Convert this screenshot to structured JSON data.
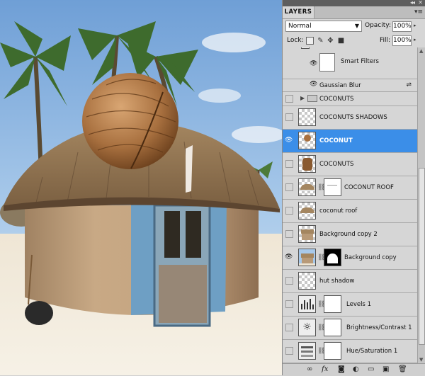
{
  "panel": {
    "tab_label": "LAYERS",
    "blend_mode": "Normal",
    "opacity_label": "Opacity:",
    "opacity_value": "100%",
    "lock_label": "Lock:",
    "fill_label": "Fill:",
    "fill_value": "100%"
  },
  "layers": [
    {
      "name": "Smart Filters",
      "kind": "smart-filters",
      "visible": true
    },
    {
      "name": "Gaussian Blur",
      "kind": "filter",
      "visible": true
    },
    {
      "name": "COCONUTS",
      "kind": "group",
      "visible": false
    },
    {
      "name": "COCONUTS SHADOWS",
      "kind": "layer",
      "visible": false
    },
    {
      "name": "COCONUT",
      "kind": "layer",
      "visible": true,
      "selected": true
    },
    {
      "name": "COCONUTS",
      "kind": "layer",
      "visible": false
    },
    {
      "name": "COCONUT ROOF",
      "kind": "masked",
      "visible": false
    },
    {
      "name": "coconut roof",
      "kind": "layer",
      "visible": false
    },
    {
      "name": "Background copy 2",
      "kind": "layer",
      "visible": false
    },
    {
      "name": "Background copy",
      "kind": "masked",
      "visible": true
    },
    {
      "name": "hut shadow",
      "kind": "layer",
      "visible": false
    },
    {
      "name": "Levels 1",
      "kind": "adjustment",
      "visible": false
    },
    {
      "name": "Brightness/Contrast 1",
      "kind": "adjustment",
      "visible": false
    },
    {
      "name": "Hue/Saturation 1",
      "kind": "adjustment",
      "visible": false
    }
  ],
  "icons": {
    "eye": "eye-icon",
    "link": "chain-link-icon",
    "fx": "fx"
  },
  "colors": {
    "selection": "#3b8ee8",
    "panel_bg": "#d6d6d6"
  }
}
